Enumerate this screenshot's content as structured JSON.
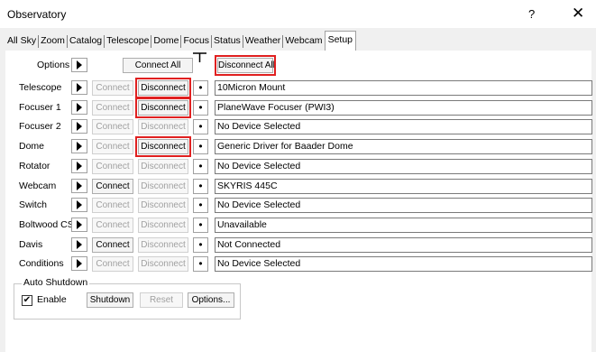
{
  "window": {
    "title": "Observatory",
    "help_glyph": "?",
    "close_glyph": "✕"
  },
  "tabs": [
    "All Sky",
    "Zoom",
    "Catalog",
    "Telescope",
    "Dome",
    "Focus",
    "Status",
    "Weather",
    "Webcam",
    "Setup"
  ],
  "active_tab": "Setup",
  "options": {
    "label": "Options",
    "connect_all": "Connect All",
    "disconnect_all": "Disconnect All"
  },
  "device_rows": [
    {
      "label": "Telescope",
      "connect": "Connect",
      "connect_enabled": false,
      "disconnect": "Disconnect",
      "disconnect_enabled": true,
      "disconnect_highlight": true,
      "value": "10Micron Mount"
    },
    {
      "label": "Focuser 1",
      "connect": "Connect",
      "connect_enabled": false,
      "disconnect": "Disconnect",
      "disconnect_enabled": true,
      "disconnect_highlight": true,
      "value": "PlaneWave Focuser (PWI3)"
    },
    {
      "label": "Focuser 2",
      "connect": "Connect",
      "connect_enabled": false,
      "disconnect": "Disconnect",
      "disconnect_enabled": false,
      "disconnect_highlight": false,
      "value": "No Device Selected"
    },
    {
      "label": "Dome",
      "connect": "Connect",
      "connect_enabled": false,
      "disconnect": "Disconnect",
      "disconnect_enabled": true,
      "disconnect_highlight": true,
      "value": "Generic Driver for Baader Dome"
    },
    {
      "label": "Rotator",
      "connect": "Connect",
      "connect_enabled": false,
      "disconnect": "Disconnect",
      "disconnect_enabled": false,
      "disconnect_highlight": false,
      "value": "No Device Selected"
    },
    {
      "label": "Webcam",
      "connect": "Connect",
      "connect_enabled": true,
      "disconnect": "Disconnect",
      "disconnect_enabled": false,
      "disconnect_highlight": false,
      "value": "SKYRIS 445C"
    },
    {
      "label": "Switch",
      "connect": "Connect",
      "connect_enabled": false,
      "disconnect": "Disconnect",
      "disconnect_enabled": false,
      "disconnect_highlight": false,
      "value": "No Device Selected"
    },
    {
      "label": "Boltwood CS",
      "connect": "Connect",
      "connect_enabled": false,
      "disconnect": "Disconnect",
      "disconnect_enabled": false,
      "disconnect_highlight": false,
      "value": "Unavailable"
    },
    {
      "label": "Davis",
      "connect": "Connect",
      "connect_enabled": true,
      "disconnect": "Disconnect",
      "disconnect_enabled": false,
      "disconnect_highlight": false,
      "value": "Not Connected"
    },
    {
      "label": "Conditions",
      "connect": "Connect",
      "connect_enabled": false,
      "disconnect": "Disconnect",
      "disconnect_enabled": false,
      "disconnect_highlight": false,
      "value": "No Device Selected"
    }
  ],
  "auto_shutdown": {
    "title": "Auto Shutdown",
    "enable_label": "Enable",
    "enable_checked": true,
    "check_glyph": "✔",
    "shutdown": "Shutdown",
    "reset": "Reset",
    "options": "Options..."
  },
  "colors": {
    "highlight": "#e02020"
  }
}
